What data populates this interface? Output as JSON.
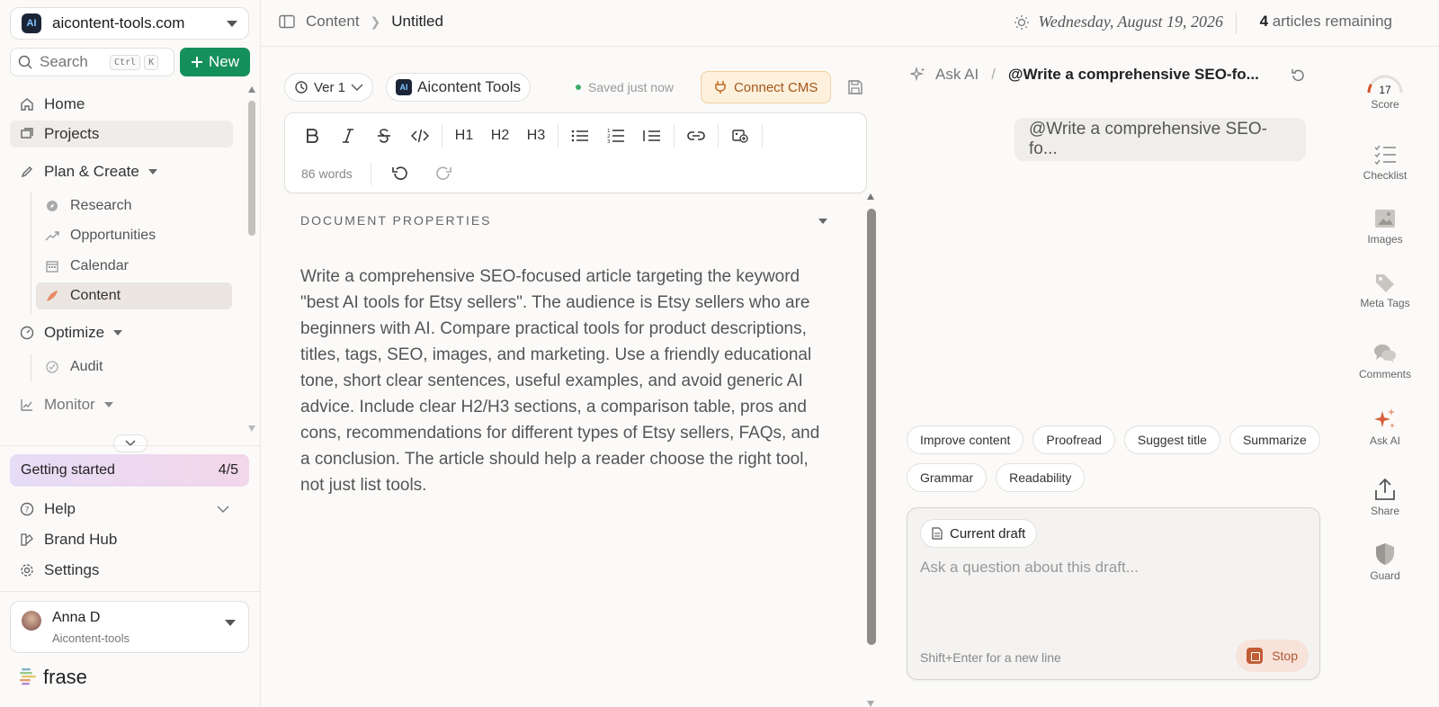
{
  "workspace": {
    "name": "aicontent-tools.com",
    "logo_text": "AI"
  },
  "search": {
    "placeholder": "Search",
    "shortcut_ctrl": "Ctrl",
    "shortcut_key": "K"
  },
  "new_button": {
    "label": "New",
    "icon": "plus-icon"
  },
  "nav": {
    "home": "Home",
    "projects": "Projects",
    "plan_create": "Plan & Create",
    "research": "Research",
    "opportunities": "Opportunities",
    "calendar": "Calendar",
    "content": "Content",
    "optimize": "Optimize",
    "audit": "Audit",
    "monitor": "Monitor"
  },
  "getting_started": {
    "label": "Getting started",
    "progress": "4/5"
  },
  "bottom_nav": {
    "help": "Help",
    "brand_hub": "Brand Hub",
    "settings": "Settings"
  },
  "user": {
    "name": "Anna D",
    "org": "Aicontent-tools"
  },
  "brand": {
    "name": "frase"
  },
  "header": {
    "breadcrumb_root": "Content",
    "breadcrumb_current": "Untitled",
    "date": "Wednesday, August 19, 2026",
    "articles_count": "4",
    "articles_label": "articles remaining"
  },
  "editor": {
    "version": "Ver 1",
    "brand_pill": "Aicontent Tools",
    "brand_logo_text": "AI",
    "saved_status": "Saved just now",
    "connect_cms": "Connect CMS",
    "toolbar": {
      "h1": "H1",
      "h2": "H2",
      "h3": "H3"
    },
    "word_count": "86 words",
    "properties_heading": "DOCUMENT PROPERTIES",
    "body": "Write a comprehensive SEO-focused article targeting the keyword \"best AI tools for Etsy sellers\". The audience is Etsy sellers who are beginners with AI. Compare practical tools for product descriptions, titles, tags, SEO, images, and marketing. Use a friendly educational tone, short clear sentences, useful examples, and avoid generic AI advice. Include clear H2/H3 sections, a comparison table, pros and cons, recommendations for different types of Etsy sellers, FAQs, and a conclusion. The article should help a reader choose the right tool, not just list tools."
  },
  "ai_panel": {
    "ask_label": "Ask AI",
    "separator": "/",
    "command": "@Write a comprehensive SEO-fo...",
    "bubble": "@Write a comprehensive SEO-fo...",
    "chips": [
      "Improve content",
      "Proofread",
      "Suggest title",
      "Summarize",
      "Grammar",
      "Readability"
    ],
    "draft_chip": "Current draft",
    "input_placeholder": "Ask a question about this draft...",
    "hint": "Shift+Enter for a new line",
    "stop": "Stop"
  },
  "rail": {
    "score_value": "17",
    "score_fraction": 0.17,
    "score": "Score",
    "checklist": "Checklist",
    "images": "Images",
    "meta_tags": "Meta Tags",
    "comments": "Comments",
    "ask_ai": "Ask AI",
    "share": "Share",
    "guard": "Guard"
  },
  "colors": {
    "accent_green": "#15905a",
    "cms_bg": "#fdf0dc",
    "cms_text": "#a2561a",
    "stop_red": "#c15c34",
    "ai_sparkle": "#d9603c"
  }
}
